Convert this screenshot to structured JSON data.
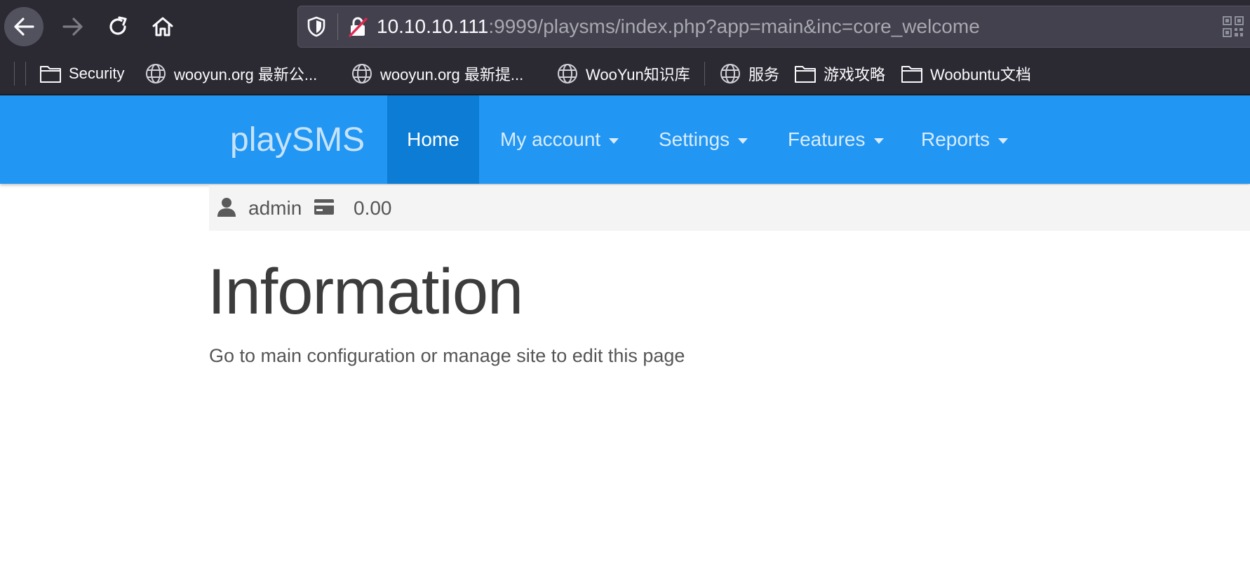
{
  "browser": {
    "url_host": "10.10.10.111",
    "url_rest": ":9999/playsms/index.php?app=main&inc=core_welcome",
    "bookmarks": [
      {
        "label": "Security",
        "icon": "folder-icon"
      },
      {
        "label": "wooyun.org 最新公...",
        "icon": "globe-icon"
      },
      {
        "label": "wooyun.org 最新提...",
        "icon": "globe-icon"
      },
      {
        "label": "WooYun知识库",
        "icon": "globe-icon"
      },
      {
        "label": "服务",
        "icon": "globe-icon"
      },
      {
        "label": "游戏攻略",
        "icon": "folder-icon"
      },
      {
        "label": "Woobuntu文档",
        "icon": "folder-icon"
      }
    ]
  },
  "navbar": {
    "brand": "playSMS",
    "items": [
      {
        "label": "Home",
        "active": true,
        "dropdown": false
      },
      {
        "label": "My account",
        "active": false,
        "dropdown": true
      },
      {
        "label": "Settings",
        "active": false,
        "dropdown": true
      },
      {
        "label": "Features",
        "active": false,
        "dropdown": true
      },
      {
        "label": "Reports",
        "active": false,
        "dropdown": true
      }
    ]
  },
  "userbar": {
    "username": "admin",
    "credit": "0.00"
  },
  "content": {
    "title": "Information",
    "text": "Go to main configuration or manage site to edit this page"
  },
  "colors": {
    "navbar_bg": "#2196f3",
    "navbar_active": "#0c7cd5",
    "browser_chrome": "#2b2a33"
  }
}
